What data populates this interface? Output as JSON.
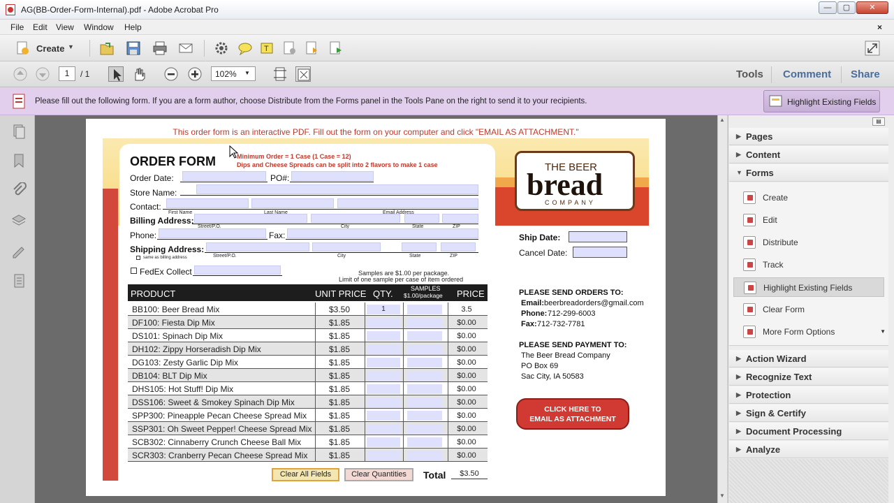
{
  "window": {
    "title": "AG(BB-Order-Form-Internal).pdf - Adobe Acrobat Pro",
    "min": "—",
    "max": "▢",
    "close": "✕"
  },
  "menu": [
    "File",
    "Edit",
    "View",
    "Window",
    "Help"
  ],
  "toolbar": {
    "create_label": "Create",
    "page_current": "1",
    "page_total": "/ 1",
    "zoom": "102%",
    "tabs": {
      "tools": "Tools",
      "comment": "Comment",
      "share": "Share"
    }
  },
  "infobar": {
    "message": "Please fill out the following form. If you are a form author, choose Distribute from the Forms panel in the Tools Pane on the right to send it to your recipients.",
    "highlight_button": "Highlight Existing Fields"
  },
  "rightpane": {
    "sections_top": [
      "Pages",
      "Content",
      "Forms"
    ],
    "forms_items": [
      "Create",
      "Edit",
      "Distribute",
      "Track",
      "Highlight Existing Fields",
      "Clear Form",
      "More Form Options"
    ],
    "sections_bottom": [
      "Action Wizard",
      "Recognize Text",
      "Protection",
      "Sign & Certify",
      "Document Processing",
      "Analyze"
    ]
  },
  "form": {
    "intro": "This order form is an interactive PDF. Fill out the form on your computer and click \"EMAIL AS ATTACHMENT.\"",
    "title": "ORDER FORM",
    "min_order": "Minimum Order = 1 Case (1 Case = 12)",
    "dips_note": "Dips and Cheese Spreads can be split into 2 flavors to make 1 case",
    "logo_line1": "THE BEER",
    "logo_line2": "bread",
    "logo_line3": "COMPANY",
    "order_date": "Order Date:",
    "po": "PO#:",
    "store_name": "Store Name:",
    "contact": "Contact:",
    "first_name": "First Name",
    "last_name": "Last Name",
    "email_address": "Email Address",
    "billing": "Billing Address:",
    "street": "Street/P.O.",
    "city": "City",
    "state": "State",
    "zip": "ZIP",
    "phone": "Phone:",
    "fax": "Fax:",
    "shipping": "Shipping Address:",
    "same_as": "same as billing address",
    "fedex": "FedEx Collect",
    "samples_note1": "Samples are $1.00 per package.",
    "samples_note2": "Limit of one sample per case of item ordered",
    "ship_date": "Ship Date:",
    "cancel_date": "Cancel Date:",
    "headers": {
      "product": "PRODUCT",
      "unit_price": "UNIT PRICE",
      "qty": "QTY.",
      "samples1": "SAMPLES",
      "samples2": "$1.00/package",
      "price": "PRICE"
    },
    "products": [
      {
        "name": "BB100: Beer Bread Mix",
        "unit": "$3.50",
        "qty": "1",
        "price": "3.5"
      },
      {
        "name": "DF100: Fiesta Dip Mix",
        "unit": "$1.85",
        "qty": "",
        "price": "$0.00"
      },
      {
        "name": "DS101: Spinach Dip Mix",
        "unit": "$1.85",
        "qty": "",
        "price": "$0.00"
      },
      {
        "name": "DH102: Zippy Horseradish Dip Mix",
        "unit": "$1.85",
        "qty": "",
        "price": "$0.00"
      },
      {
        "name": "DG103: Zesty Garlic Dip Mix",
        "unit": "$1.85",
        "qty": "",
        "price": "$0.00"
      },
      {
        "name": "DB104: BLT Dip Mix",
        "unit": "$1.85",
        "qty": "",
        "price": "$0.00"
      },
      {
        "name": "DHS105: Hot Stuff! Dip Mix",
        "unit": "$1.85",
        "qty": "",
        "price": "$0.00"
      },
      {
        "name": "DSS106: Sweet & Smokey Spinach Dip Mix",
        "unit": "$1.85",
        "qty": "",
        "price": "$0.00"
      },
      {
        "name": "SPP300: Pineapple Pecan Cheese Spread Mix",
        "unit": "$1.85",
        "qty": "",
        "price": "$0.00"
      },
      {
        "name": "SSP301: Oh Sweet Pepper! Cheese Spread Mix",
        "unit": "$1.85",
        "qty": "",
        "price": "$0.00"
      },
      {
        "name": "SCB302: Cinnaberry Crunch Cheese Ball Mix",
        "unit": "$1.85",
        "qty": "",
        "price": "$0.00"
      },
      {
        "name": "SCR303: Cranberry Pecan Cheese Spread Mix",
        "unit": "$1.85",
        "qty": "",
        "price": "$0.00"
      }
    ],
    "clear_all": "Clear All Fields",
    "clear_qty": "Clear Quantities",
    "total_label": "Total",
    "total_value": "$3.50",
    "send_orders": "PLEASE SEND ORDERS TO:",
    "email_label": "Email:",
    "email_value": "beerbreadorders@gmail.com",
    "phone_label": "Phone:",
    "phone_value": "712-299-6003",
    "fax_label": "Fax:",
    "fax_value": "712-732-7781",
    "send_payment": "PLEASE SEND PAYMENT TO:",
    "pay_line1": "The Beer Bread Company",
    "pay_line2": "PO Box 69",
    "pay_line3": "Sac City, IA 50583",
    "email_btn1": "CLICK HERE TO",
    "email_btn2": "EMAIL AS ATTACHMENT"
  }
}
